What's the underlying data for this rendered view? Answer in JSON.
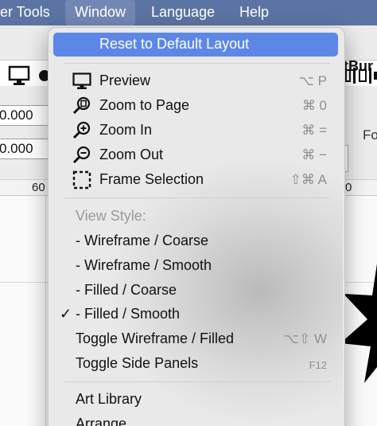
{
  "menubar": {
    "items": [
      "er Tools",
      "Window",
      "Language",
      "Help"
    ]
  },
  "app": {
    "brand_partial": "tBur",
    "fields": [
      "0.000",
      "0.000"
    ],
    "ruler_labels": [
      "60",
      "0"
    ],
    "right_label": "Fo"
  },
  "menu": {
    "reset": "Reset to Default Layout",
    "view_items": [
      {
        "label": "Preview",
        "shortcut": "⌥ P",
        "icon": "monitor-icon"
      },
      {
        "label": "Zoom to Page",
        "shortcut": "⌘ 0",
        "icon": "zoom-page-icon"
      },
      {
        "label": "Zoom In",
        "shortcut": "⌘ =",
        "icon": "zoom-in-icon"
      },
      {
        "label": "Zoom Out",
        "shortcut": "⌘ −",
        "icon": "zoom-out-icon"
      },
      {
        "label": "Frame Selection",
        "shortcut": "⇧⌘ A",
        "icon": "frame-selection-icon"
      }
    ],
    "view_style_heading": "View Style:",
    "styles": [
      {
        "label": "-  Wireframe / Coarse",
        "checked": false
      },
      {
        "label": "-  Wireframe / Smooth",
        "checked": false
      },
      {
        "label": "-  Filled / Coarse",
        "checked": false
      },
      {
        "label": "-  Filled / Smooth",
        "checked": true
      }
    ],
    "toggle_wireframe": {
      "label": "Toggle Wireframe / Filled",
      "shortcut": "⌥⇧ W"
    },
    "toggle_panels": {
      "label": "Toggle Side Panels",
      "shortcut": "F12"
    },
    "art_library": "Art Library",
    "arrange": "Arrange",
    "check_mark": "✓"
  }
}
